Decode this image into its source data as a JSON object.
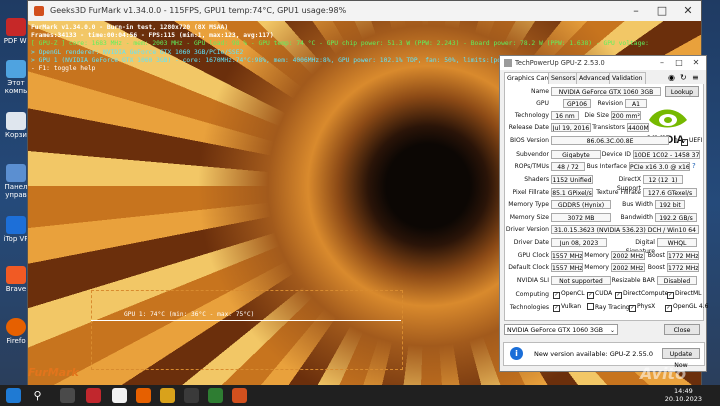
{
  "desktop": {
    "icons": [
      {
        "label": "PDF Wi",
        "icon": "pdf-icon"
      },
      {
        "label": "Этот компь",
        "icon": "computer-icon"
      },
      {
        "label": "Корзи",
        "icon": "recycle-bin-icon"
      },
      {
        "label": "Панел управ",
        "icon": "control-panel-icon"
      },
      {
        "label": "iTop VP",
        "icon": "itop-vpn-icon"
      },
      {
        "label": "Brave",
        "icon": "brave-icon"
      },
      {
        "label": "Firefo",
        "icon": "firefox-icon"
      }
    ]
  },
  "furmark": {
    "title": "Geeks3D FurMark v1.34.0.0 - 115FPS, GPU1 temp:74°C, GPU1 usage:98%",
    "overlay": [
      "FurMark v1.34.0.0 - Burn-in test, 1280x720 (8X MSAA)",
      "Frames:34133 - time:00:04:56 - FPS:115 (min:1, max:123, avg:117)",
      "[ GPU-Z ] core: 1683 MHz - mem: 2003 MHz - GPU load: 98 % - GPU temp: 74 °C - GPU chip power: 51.3 W (PPW: 2.243) - Board power: 78.2 W (PPW: 1.638) - GPU voltage:",
      "> OpenGL renderer: NVIDIA GeForce GTX 1060 3GB/PCIe/SSE2",
      "> GPU 1 (NVIDIA GeForce GTX 1060 3GB) - core: 1670MHz:74°C:98%, mem: 4006MHz:8%, GPU power: 102.1% TDP, fan: 50%, limits:[power:1, temp:0, volt:0, OV:0]",
      "- F1: toggle help"
    ],
    "graph_label": "GPU 1: 74°C (min: 36°C - max: 75°C)",
    "logo": "FurMark"
  },
  "gpuz": {
    "title": "TechPowerUp GPU-Z 2.53.0",
    "tabs": [
      "Graphics Card",
      "Sensors",
      "Advanced",
      "Validation"
    ],
    "lookup_label": "Lookup",
    "nvidia_text": "NVIDIA",
    "fields": {
      "name": "NVIDIA GeForce GTX 1060 3GB",
      "gpu": "GP106",
      "revision": "A1",
      "technology": "16 nm",
      "die_size": "200 mm²",
      "release_date": "Jul 19, 2016",
      "transistors": "4400M",
      "bios_version": "86.06.3C.00.8E",
      "uefi": "UEFI",
      "subvendor": "Gigabyte",
      "device_id": "10DE 1C02 - 1458 3724",
      "rops_tmus": "48 / 72",
      "bus_interface": "PCIe x16 3.0 @ x16 3.0",
      "shaders": "1152 Unified",
      "directx_support": "12 (12_1)",
      "pixel_fillrate": "85.1 GPixel/s",
      "texture_fillrate": "127.6 GTexel/s",
      "memory_type": "GDDR5 (Hynix)",
      "bus_width": "192 bit",
      "memory_size": "3072 MB",
      "bandwidth": "192.2 GB/s",
      "driver_version": "31.0.15.3623 (NVIDIA 536.23) DCH / Win10 64",
      "driver_date": "Jun 08, 2023",
      "digital_signature": "WHQL",
      "gpu_clock": "1557 MHz",
      "memory_clock": "2002 MHz",
      "boost_clock": "1772 MHz",
      "default_clock": "1557 MHz",
      "default_memory": "2002 MHz",
      "default_boost": "1772 MHz",
      "nvidia_sli": "Not supported",
      "resizable_bar": "Disabled"
    },
    "labels": {
      "name": "Name",
      "gpu": "GPU",
      "revision": "Revision",
      "technology": "Technology",
      "die_size": "Die Size",
      "release_date": "Release Date",
      "transistors": "Transistors",
      "bios_version": "BIOS Version",
      "subvendor": "Subvendor",
      "device_id": "Device ID",
      "rops_tmus": "ROPs/TMUs",
      "bus_interface": "Bus Interface",
      "shaders": "Shaders",
      "directx_support": "DirectX Support",
      "pixel_fillrate": "Pixel Fillrate",
      "texture_fillrate": "Texture Fillrate",
      "memory_type": "Memory Type",
      "bus_width": "Bus Width",
      "memory_size": "Memory Size",
      "bandwidth": "Bandwidth",
      "driver_version": "Driver Version",
      "driver_date": "Driver Date",
      "digital_signature": "Digital Signature",
      "gpu_clock": "GPU Clock",
      "memory": "Memory",
      "boost": "Boost",
      "default_clock": "Default Clock",
      "nvidia_sli": "NVIDIA SLI",
      "resizable_bar": "Resizable BAR",
      "computing": "Computing",
      "technologies": "Technologies"
    },
    "computing": [
      "OpenCL",
      "CUDA",
      "DirectCompute",
      "DirectML"
    ],
    "technologies": [
      "Vulkan",
      "Ray Tracing",
      "PhysX",
      "OpenGL 4.6"
    ],
    "gpu_select": "NVIDIA GeForce GTX 1060 3GB",
    "close_label": "Close",
    "notice_text": "New version available: GPU-Z 2.55.0",
    "update_label": "Update Now"
  },
  "taskbar": {
    "time": "20.10.2023",
    "time_top": "14:49"
  },
  "watermark": "Avito"
}
